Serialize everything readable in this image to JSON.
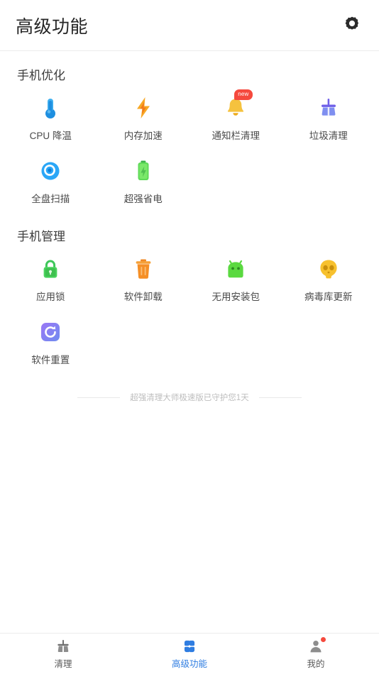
{
  "header": {
    "title": "高级功能",
    "settings_icon": "gear-icon"
  },
  "sections": [
    {
      "title": "手机优化",
      "items": [
        {
          "label": "CPU 降温",
          "icon": "thermometer-icon",
          "color": "#2e9bf0",
          "badge": ""
        },
        {
          "label": "内存加速",
          "icon": "lightning-icon",
          "color": "#f5a623",
          "badge": ""
        },
        {
          "label": "通知栏清理",
          "icon": "bell-icon",
          "color": "#f5c542",
          "badge": "new"
        },
        {
          "label": "垃圾清理",
          "icon": "broom-icon",
          "color": "#7b68ee",
          "badge": ""
        },
        {
          "label": "全盘扫描",
          "icon": "scan-radar-icon",
          "color": "#1e9bf5",
          "badge": ""
        },
        {
          "label": "超强省电",
          "icon": "battery-icon",
          "color": "#4ccb5a",
          "badge": ""
        }
      ]
    },
    {
      "title": "手机管理",
      "items": [
        {
          "label": "应用锁",
          "icon": "lock-icon",
          "color": "#3ec75a",
          "badge": ""
        },
        {
          "label": "软件卸载",
          "icon": "trash-icon",
          "color": "#f5933a",
          "badge": ""
        },
        {
          "label": "无用安装包",
          "icon": "android-icon",
          "color": "#5ad940",
          "badge": ""
        },
        {
          "label": "病毒库更新",
          "icon": "skull-virus-icon",
          "color": "#f7c12e",
          "badge": ""
        },
        {
          "label": "软件重置",
          "icon": "refresh-icon",
          "color": "#8b6ef0",
          "badge": ""
        }
      ]
    }
  ],
  "footer_note": {
    "text": "超强清理大师极速版已守护您1天"
  },
  "bottom_nav": {
    "active_color": "#2f7de1",
    "items": [
      {
        "label": "清理",
        "icon": "broom-nav-icon",
        "active": false,
        "dot": false
      },
      {
        "label": "高级功能",
        "icon": "clover-nav-icon",
        "active": true,
        "dot": false
      },
      {
        "label": "我的",
        "icon": "person-nav-icon",
        "active": false,
        "dot": true
      }
    ]
  }
}
